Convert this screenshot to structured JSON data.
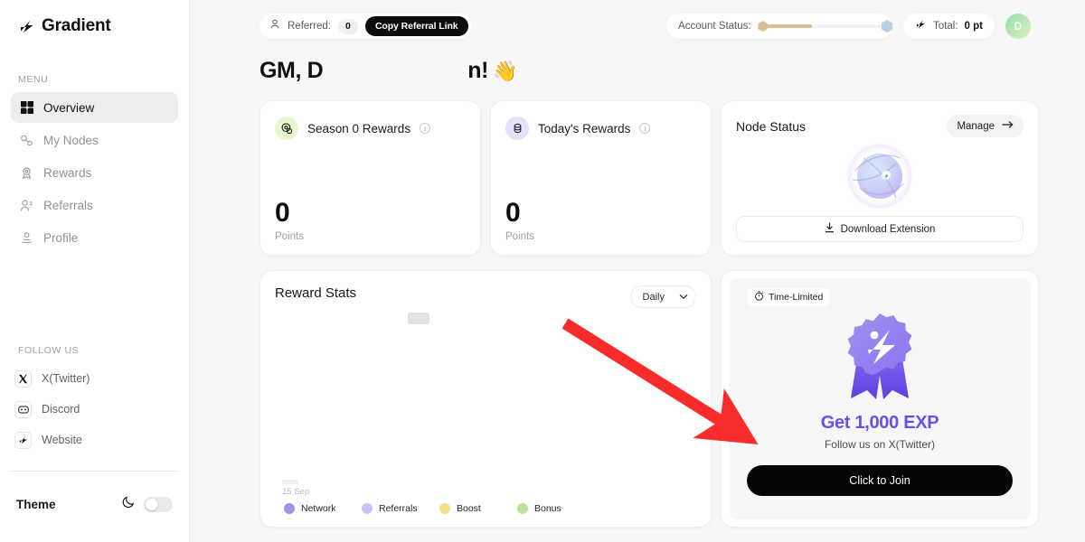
{
  "brand": {
    "name": "Gradient",
    "logo_icon": "gradient-logo-icon"
  },
  "sidebar": {
    "menu_label": "MENU",
    "items": [
      {
        "label": "Overview",
        "icon": "grid-icon",
        "active": true
      },
      {
        "label": "My Nodes",
        "icon": "nodes-icon",
        "active": false
      },
      {
        "label": "Rewards",
        "icon": "rewards-icon",
        "active": false
      },
      {
        "label": "Referrals",
        "icon": "users-icon",
        "active": false
      },
      {
        "label": "Profile",
        "icon": "profile-icon",
        "active": false
      }
    ],
    "follow_label": "FOLLOW US",
    "social": [
      {
        "label": "X(Twitter)",
        "icon": "x-twitter-icon"
      },
      {
        "label": "Discord",
        "icon": "discord-icon"
      },
      {
        "label": "Website",
        "icon": "website-icon"
      }
    ],
    "theme": {
      "label": "Theme",
      "mode_icon": "moon-icon",
      "enabled": false
    }
  },
  "topbar": {
    "referred_label": "Referred:",
    "referred_count": "0",
    "copy_referral_label": "Copy Referral Link",
    "account_status_label": "Account Status:",
    "account_status_progress": 42,
    "total_label": "Total:",
    "total_value": "0 pt",
    "avatar_initial": "D"
  },
  "greeting": {
    "prefix": "GM, D",
    "suffix": "n!",
    "wave": "👋"
  },
  "cards": {
    "season": {
      "title": "Season 0 Rewards",
      "icon": "coins-icon",
      "value": "0",
      "unit": "Points",
      "info_icon": "info-icon"
    },
    "today": {
      "title": "Today's Rewards",
      "icon": "coin-stack-icon",
      "value": "0",
      "unit": "Points",
      "info_icon": "info-icon"
    },
    "node_status": {
      "title": "Node Status",
      "manage_label": "Manage",
      "manage_arrow_icon": "arrow-right-icon",
      "download_label": "Download Extension",
      "download_icon": "download-icon",
      "globe_icon": "network-globe-icon"
    },
    "reward_stats": {
      "title": "Reward Stats",
      "range_value": "Daily",
      "range_chevron_icon": "chevron-down-icon"
    },
    "promo": {
      "badge_label": "Time-Limited",
      "badge_icon": "timer-icon",
      "medal_icon": "medal-icon",
      "title": "Get 1,000 EXP",
      "subtitle": "Follow us on X(Twitter)",
      "cta_label": "Click to Join",
      "accent_color": "#6c4ef0"
    }
  },
  "chart_data": {
    "type": "bar",
    "title": "Reward Stats",
    "range": "Daily",
    "categories": [
      "15 Sep"
    ],
    "xlabel": "",
    "ylabel": "",
    "grid": false,
    "legend_position": "bottom",
    "series": [
      {
        "name": "Network",
        "color": "#a391e8",
        "values": [
          0
        ]
      },
      {
        "name": "Referrals",
        "color": "#c7c3f5",
        "values": [
          0
        ]
      },
      {
        "name": "Boost",
        "color": "#f5dd8a",
        "values": [
          0
        ]
      },
      {
        "name": "Bonus",
        "color": "#b8e39a",
        "values": [
          0
        ]
      }
    ]
  },
  "annotation": {
    "arrow_color": "#f92c2c",
    "from": [
      625,
      358
    ],
    "to": [
      826,
      484
    ]
  }
}
